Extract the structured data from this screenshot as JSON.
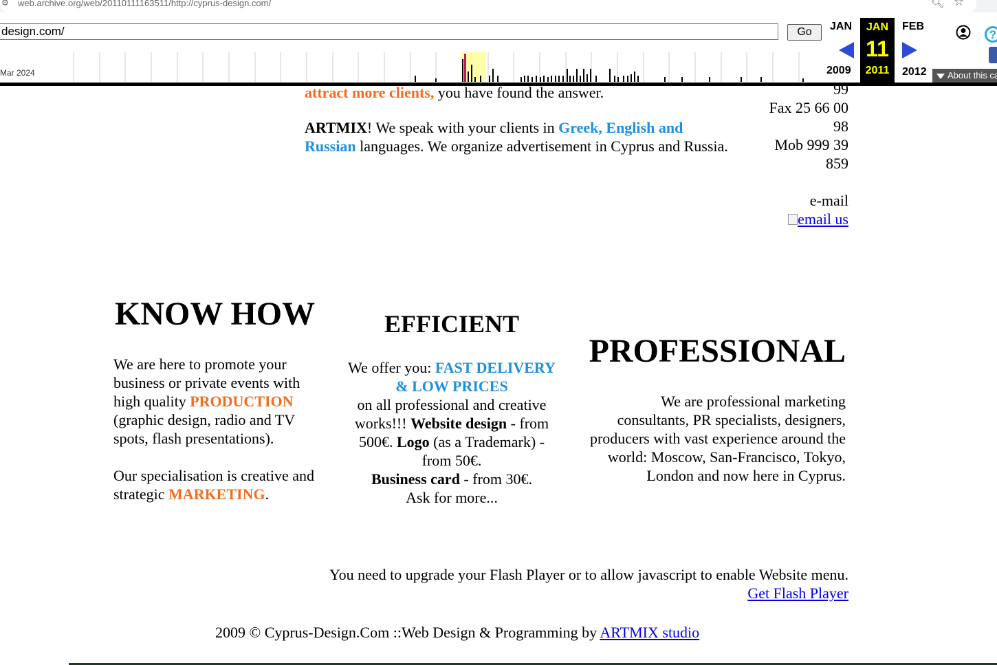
{
  "browser": {
    "url": "web.archive.org/web/20110111163511/http://cyprus-design.com/",
    "zoom_icon": "magnifier-icon",
    "bookmark_icon": "star-icon"
  },
  "wayback": {
    "url_input_value": "design.com/",
    "go_label": "Go",
    "sparkline_label": "Mar 2024",
    "prev_month": "JAN",
    "prev_year": "2009",
    "current_month": "JAN",
    "current_day": "11",
    "current_year": "2011",
    "next_month": "FEB",
    "next_year": "2012",
    "about_label": "About this capture",
    "colors": {
      "current_bg": "#000000",
      "current_text": "#ffff00",
      "arrow": "#2c4cd8",
      "about_bg": "#555555"
    }
  },
  "intro": {
    "partial_line_orange": "attract more clients,",
    "partial_line_rest": " you have found the answer.",
    "artmix_name": "ARTMIX",
    "artmix_text_1": "! We speak with your clients in ",
    "artmix_languages": "Greek, English and Russian",
    "artmix_text_2": " languages. We organize advertisement in Cyprus and Russia."
  },
  "contact": {
    "partial_line": "99",
    "fax_line1": "Fax 25 66 00",
    "fax_line2": "98",
    "mob_line1": "Mob 999 39",
    "mob_line2": "859",
    "email_label": "e-mail",
    "email_link": "email us"
  },
  "know_how": {
    "title": "KNOW HOW",
    "para1_a": "We are here to promote your business or private events with high quality ",
    "para1_highlight": "PRODUCTION",
    "para1_b": " (graphic design, radio and TV spots, flash presentations).",
    "para2_a": "Our specialisation is creative and strategic ",
    "para2_highlight": "MARKETING",
    "para2_b": "."
  },
  "efficient": {
    "title": "EFFICIENT",
    "intro": "We offer you: ",
    "highlight": "FAST DELIVERY & LOW PRICES",
    "text_a": "on all professional and creative works!!! ",
    "website_label": "Website design",
    "website_price": " - from 500€.  ",
    "logo_label": "Logo",
    "logo_price": " (as a Trademark) - from 50€.",
    "card_label": "Business card",
    "card_price": " - from 30€.",
    "ask_more": "Ask for more..."
  },
  "professional": {
    "title": "PROFESSIONAL",
    "text": "We are professional marketing consultants, PR specialists, designers, producers with vast experience around the world: Moscow, San-Francisco, Tokyo, London and now here in Cyprus."
  },
  "flash_notice": {
    "text": "You need to upgrade your Flash Player or to allow javascript to enable Website menu.",
    "link": "Get Flash Player"
  },
  "footer": {
    "text": "2009 © Cyprus-Design.Com ::Web Design & Programming by ",
    "link": "ARTMIX studio"
  }
}
